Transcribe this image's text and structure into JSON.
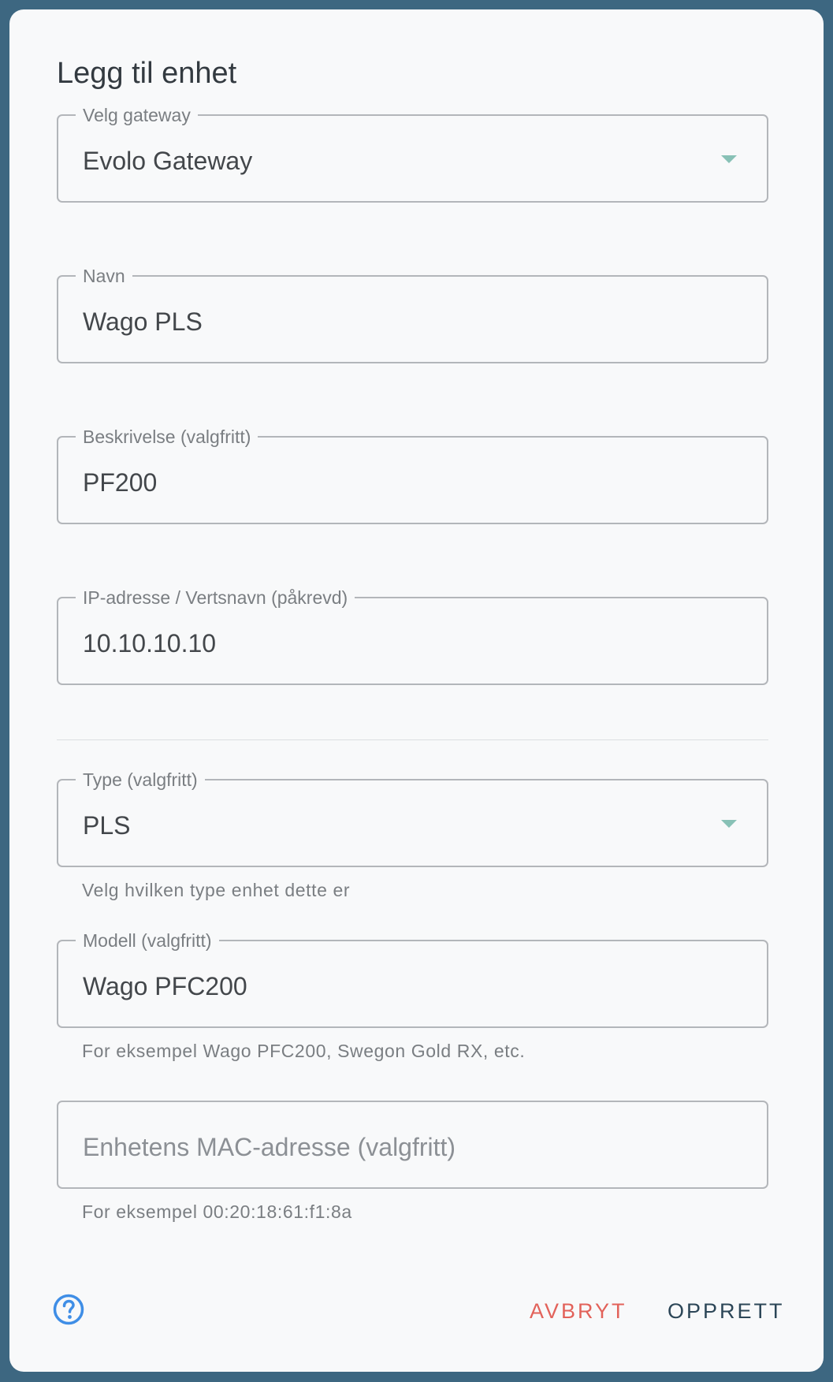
{
  "dialog": {
    "title": "Legg til enhet"
  },
  "fields": {
    "gateway": {
      "label": "Velg gateway",
      "value": "Evolo Gateway"
    },
    "name": {
      "label": "Navn",
      "value": "Wago PLS"
    },
    "description": {
      "label": "Beskrivelse (valgfritt)",
      "value": "PF200"
    },
    "ip": {
      "label": "IP-adresse / Vertsnavn (påkrevd)",
      "value": "10.10.10.10"
    },
    "type": {
      "label": "Type (valgfritt)",
      "value": "PLS",
      "helper": "Velg hvilken type enhet dette er"
    },
    "model": {
      "label": "Modell (valgfritt)",
      "value": "Wago PFC200",
      "helper": "For eksempel Wago PFC200, Swegon Gold RX, etc."
    },
    "mac": {
      "placeholder": "Enhetens MAC-adresse (valgfritt)",
      "value": "",
      "helper": "For eksempel 00:20:18:61:f1:8a"
    }
  },
  "actions": {
    "help_icon": "help-circle-icon",
    "cancel_label": "AVBRYT",
    "create_label": "OPPRETT"
  },
  "colors": {
    "background": "#3d6781",
    "dialog": "#f8f9fa",
    "cancel": "#e2625a",
    "create": "#2c4657",
    "help_icon": "#3f8ee6",
    "select_arrow": "#88c1b6"
  }
}
